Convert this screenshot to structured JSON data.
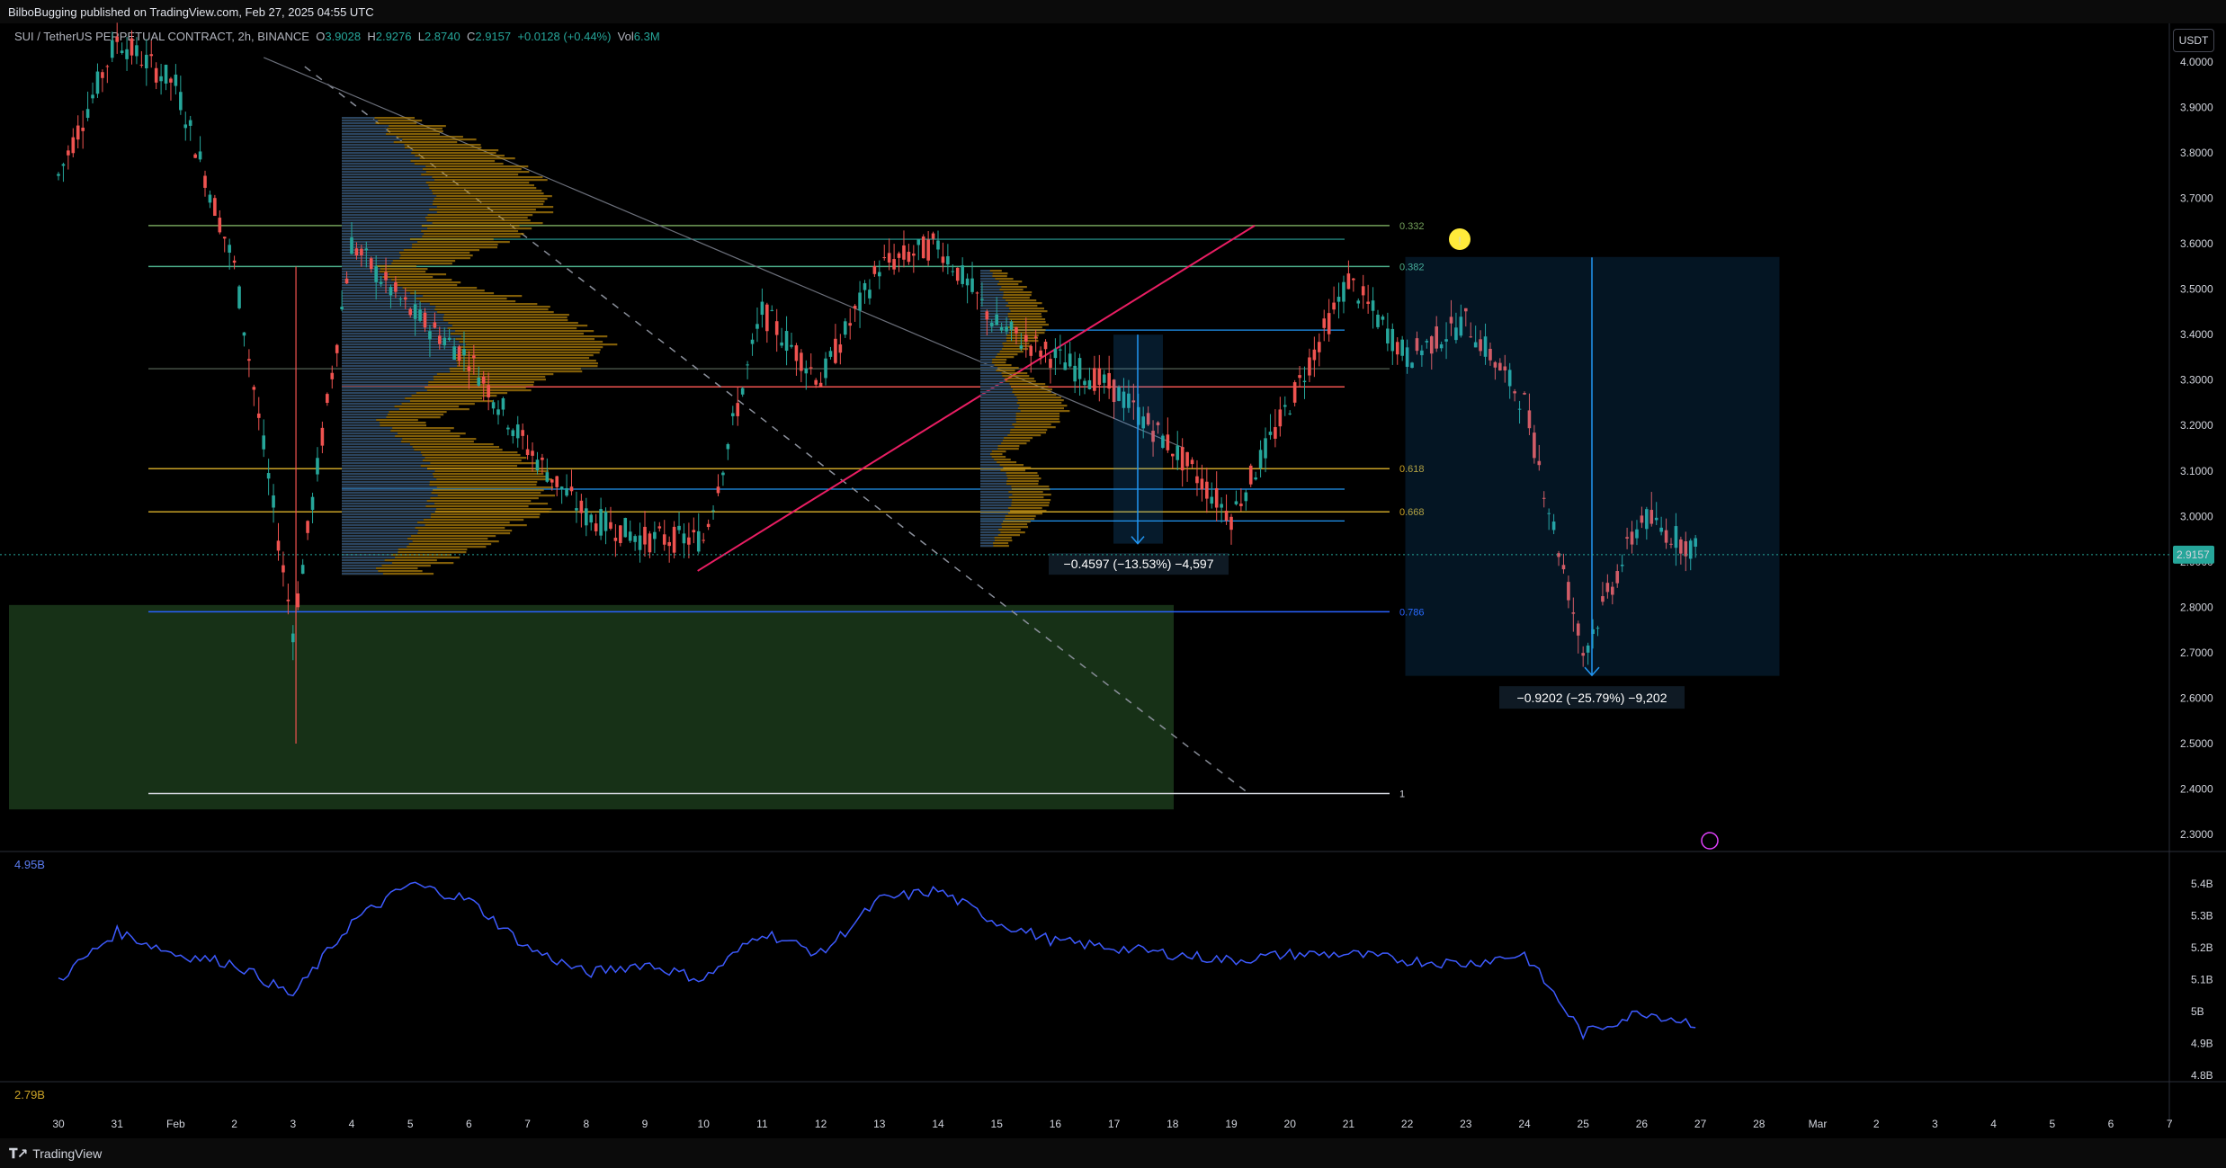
{
  "header": {
    "published": "BilboBugging published on TradingView.com, Feb 27, 2025 04:55 UTC"
  },
  "legend": {
    "symbol": "SUI / TetherUS PERPETUAL CONTRACT, 2h, BINANCE",
    "o_label": "O",
    "o": "3.9028",
    "h_label": "H",
    "h": "2.9276",
    "l_label": "L",
    "l": "2.8740",
    "c_label": "C",
    "c": "2.9157",
    "change": "+0.0128 (+0.44%)",
    "vol_label": "Vol",
    "vol": "6.3M"
  },
  "currency": "USDT",
  "last_price": "2.9157",
  "volume_pane": {
    "max_label": "4.95B",
    "min_label": "2.79B"
  },
  "footer": {
    "brand": "TradingView"
  },
  "colors": {
    "up": "#26a69a",
    "down": "#ef5350",
    "fib_green": "#73a05a",
    "fib_orange": "#c9a227",
    "fib_blue": "#2962ff",
    "trend_pink": "#e91e63",
    "measure_blue": "#2196f3",
    "volume_line": "#3d5afe",
    "demand_zone": "#1b3a1b"
  },
  "chart_data": [
    {
      "type": "line",
      "subtype": "candlestick",
      "title": "SUI / TetherUS PERPETUAL CONTRACT, 2h, BINANCE",
      "y_axis": {
        "ticks": [
          "4.0000",
          "3.9000",
          "3.8000",
          "3.7000",
          "3.6000",
          "3.5000",
          "3.4000",
          "3.3000",
          "3.2000",
          "3.1000",
          "3.0000",
          "2.9000",
          "2.8000",
          "2.7000",
          "2.6000",
          "2.5000",
          "2.4000",
          "2.3000"
        ],
        "ylim": [
          2.28,
          4.02
        ],
        "position": "right"
      },
      "x_axis": {
        "ticks": [
          "30",
          "31",
          "Feb",
          "2",
          "3",
          "4",
          "5",
          "6",
          "7",
          "8",
          "9",
          "10",
          "11",
          "12",
          "13",
          "14",
          "15",
          "16",
          "17",
          "18",
          "19",
          "20",
          "21",
          "22",
          "23",
          "24",
          "25",
          "26",
          "27",
          "28",
          "Mar",
          "2",
          "3",
          "4",
          "5",
          "6",
          "7"
        ]
      },
      "x": [
        "Jan 30",
        "Jan 31",
        "Feb 1",
        "Feb 2",
        "Feb 3",
        "Feb 4",
        "Feb 5",
        "Feb 6",
        "Feb 7",
        "Feb 8",
        "Feb 9",
        "Feb 10",
        "Feb 11",
        "Feb 12",
        "Feb 13",
        "Feb 14",
        "Feb 15",
        "Feb 16",
        "Feb 17",
        "Feb 18",
        "Feb 19",
        "Feb 20",
        "Feb 21",
        "Feb 22",
        "Feb 23",
        "Feb 24",
        "Feb 25",
        "Feb 26",
        "Feb 27"
      ],
      "series": [
        {
          "name": "SUI",
          "values": [
            3.75,
            4.05,
            3.95,
            3.55,
            2.75,
            3.6,
            3.45,
            3.35,
            3.15,
            3.0,
            2.95,
            2.95,
            3.45,
            3.3,
            3.55,
            3.6,
            3.42,
            3.35,
            3.28,
            3.15,
            3.0,
            3.25,
            3.52,
            3.35,
            3.43,
            3.25,
            2.7,
            3.0,
            2.92
          ]
        }
      ],
      "fib_levels": [
        {
          "label": "0.332",
          "value": 3.64
        },
        {
          "label": "0.382",
          "value": 3.55
        },
        {
          "label": "0.618",
          "value": 3.105
        },
        {
          "label": "0.668",
          "value": 3.01
        },
        {
          "label": "0.786",
          "value": 2.79
        },
        {
          "label": "1",
          "value": 2.39
        }
      ],
      "annotations": [
        {
          "label": "−0.4597 (−13.53%) −4,597",
          "from": 3.4,
          "to": 2.94
        },
        {
          "label": "−0.9202 (−25.79%) −9,202",
          "from": 3.57,
          "to": 2.65
        }
      ],
      "grid": false
    },
    {
      "type": "line",
      "y_axis": {
        "ticks": [
          "5.4B",
          "5.3B",
          "5.2B",
          "5.1B",
          "5B",
          "4.9B",
          "4.8B"
        ],
        "ylim": [
          4.77,
          5.48
        ]
      },
      "series": [
        {
          "name": "4.95B",
          "values": [
            5.1,
            5.25,
            5.18,
            5.15,
            5.05,
            5.28,
            5.4,
            5.35,
            5.2,
            5.12,
            5.15,
            5.1,
            5.25,
            5.18,
            5.35,
            5.38,
            5.28,
            5.22,
            5.2,
            5.18,
            5.16,
            5.18,
            5.18,
            5.16,
            5.15,
            5.18,
            4.93,
            5.0,
            4.96
          ]
        }
      ]
    }
  ]
}
